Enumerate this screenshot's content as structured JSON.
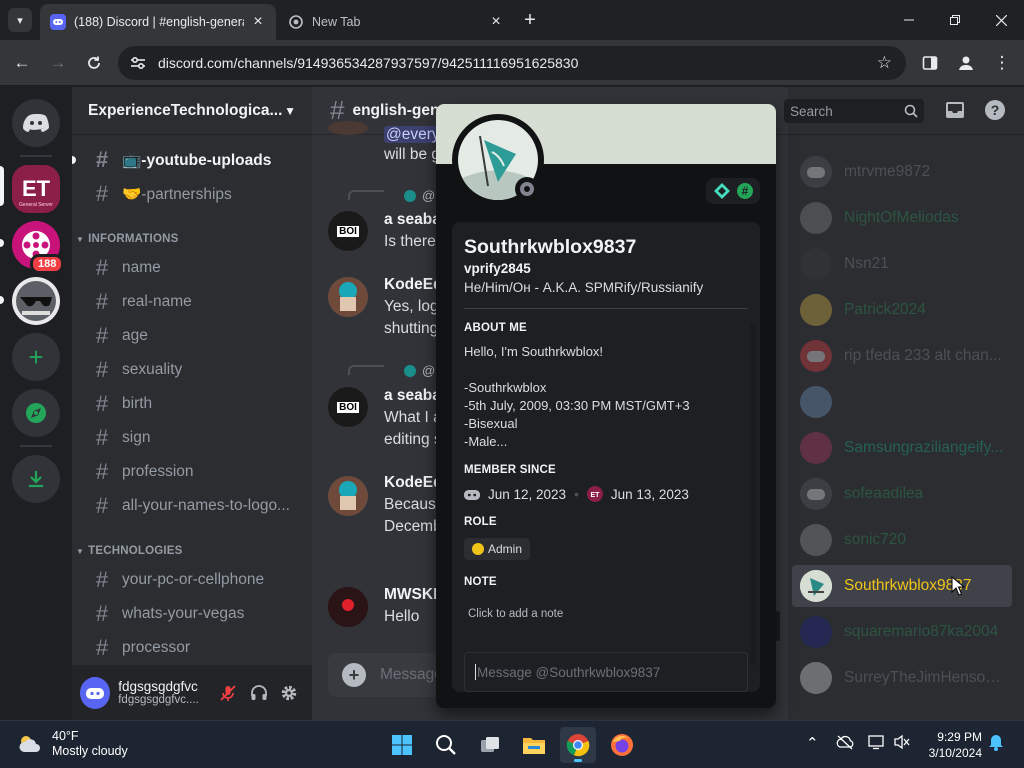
{
  "browser": {
    "tabs": [
      {
        "title": "(188) Discord | #english-genera",
        "active": true
      },
      {
        "title": "New Tab",
        "active": false
      }
    ],
    "url": "discord.com/channels/914936534287937597/942511116951625830"
  },
  "discord": {
    "servers": [
      {
        "name": "Home",
        "icon": "discord-logo-icon"
      },
      {
        "name": "ExperienceTechnological",
        "icon": "et-server-icon",
        "selected": true
      },
      {
        "name": "Film server",
        "icon": "film-reel-icon",
        "badge": "188"
      },
      {
        "name": "Sunglasses server",
        "icon": "sunglasses-icon"
      },
      {
        "name": "Add a Server",
        "icon": "plus-icon"
      },
      {
        "name": "Explore Discoverable Servers",
        "icon": "compass-icon"
      },
      {
        "name": "Download Apps",
        "icon": "download-icon"
      }
    ],
    "guild_name": "ExperienceTechnologica...",
    "channels_top": [
      {
        "name": "📺-youtube-uploads",
        "unread": true
      },
      {
        "name": "🤝-partnerships",
        "unread": false
      }
    ],
    "categories": [
      {
        "name": "INFORMATIONS",
        "channels": [
          "name",
          "real-name",
          "age",
          "sexuality",
          "birth",
          "sign",
          "profession",
          "all-your-names-to-logo..."
        ]
      },
      {
        "name": "TECHNOLOGIES",
        "channels": [
          "your-pc-or-cellphone",
          "whats-your-vegas",
          "processor"
        ]
      }
    ],
    "user_panel": {
      "display_name": "fdgsgsgdgfvc",
      "username": "fdgsgsgdgfvc...."
    },
    "chat": {
      "channel": "english-gene",
      "messages": [
        {
          "kind": "continuation",
          "mention": "@every",
          "text": "will be g"
        },
        {
          "kind": "reply",
          "reply_to": "@Koo",
          "author": "a seaba",
          "text": "Is there",
          "avatar_text": "BOI"
        },
        {
          "kind": "normal",
          "author": "KodeEd",
          "lines": [
            "Yes, logo",
            "shutting"
          ]
        },
        {
          "kind": "reply",
          "reply_to": "@Koo",
          "author": "a seaba",
          "lines": [
            "What I a",
            "editing s"
          ],
          "avatar_text": "BOI"
        },
        {
          "kind": "normal",
          "author": "KodeEd",
          "lines": [
            "Because",
            "Decemb"
          ]
        },
        {
          "kind": "normal",
          "author": "MWSKN",
          "lines": [
            "Hello"
          ]
        }
      ],
      "input_placeholder": "Message"
    },
    "search_placeholder": "Search",
    "members": [
      {
        "name": "mtrvme9872",
        "color": "#8a8e96",
        "dim": true
      },
      {
        "name": "NightOfMeliodas",
        "color": "#2f9e5c",
        "dim": true
      },
      {
        "name": "Nsn21",
        "color": "#8a8e96",
        "dim": true
      },
      {
        "name": "Patrick2024",
        "color": "#2f9e5c",
        "dim": true
      },
      {
        "name": "rip tfeda 233 alt chan...",
        "color": "#8a8e96",
        "dim": true
      },
      {
        "name": "",
        "color": "#5f64d6",
        "dim": true
      },
      {
        "name": "Samsungraziliangeify...",
        "color": "#1abc9c",
        "dim": true
      },
      {
        "name": "sofeaadilea",
        "color": "#2f9e5c",
        "dim": true
      },
      {
        "name": "sonic720",
        "color": "#2f9e5c",
        "dim": true
      },
      {
        "name": "Southrkwblox9837",
        "color": "#f0c419",
        "selected": true
      },
      {
        "name": "squaremario87ka2004",
        "color": "#2f9e5c",
        "dim": true
      },
      {
        "name": "SurreyTheJimHenson...",
        "color": "#8a8e96",
        "dim": true
      }
    ],
    "profile": {
      "display_name": "Southrkwblox9837",
      "username": "vprify2845",
      "pronouns": "He/Him/Он - A.K.A. SPMRify/Russianify",
      "about_heading": "ABOUT ME",
      "about_lines": [
        "Hello, I'm Southrkwblox!",
        "",
        "-Southrkwblox",
        "-5th July, 2009, 03:30 PM MST/GMT+3",
        "-Bisexual",
        "-Male..."
      ],
      "member_since_heading": "MEMBER SINCE",
      "discord_since": "Jun 12, 2023",
      "server_since": "Jun 13, 2023",
      "role_heading": "ROLE",
      "role": "Admin",
      "role_color": "#f0c419",
      "note_heading": "NOTE",
      "note_placeholder": "Click to add a note",
      "dm_placeholder": "Message @Southrkwblox9837",
      "banner_color": "#d6ddd3"
    }
  },
  "taskbar": {
    "weather_temp": "40°F",
    "weather_desc": "Mostly cloudy",
    "time": "9:29 PM",
    "date": "3/10/2024"
  }
}
